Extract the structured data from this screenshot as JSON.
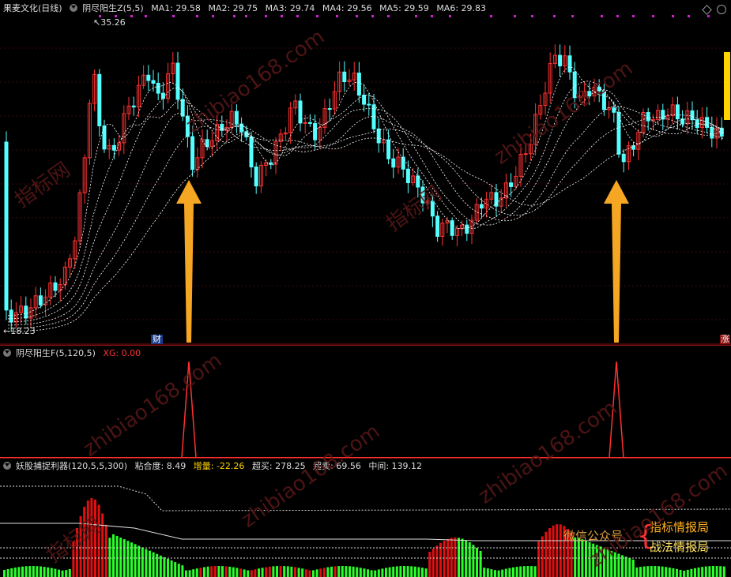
{
  "main": {
    "stock_title": "果麦文化(日线)",
    "indicator": "阴尽阳生Z(5,5)",
    "ma": [
      {
        "label": "MA1: 29.58",
        "color": "#ffffff"
      },
      {
        "label": "MA2: 29.75",
        "color": "#ffffff"
      },
      {
        "label": "MA3: 29.74",
        "color": "#ffffff"
      },
      {
        "label": "MA4: 29.56",
        "color": "#ffffff"
      },
      {
        "label": "MA5: 29.59",
        "color": "#ffffff"
      },
      {
        "label": "MA6: 29.83",
        "color": "#ffffff"
      }
    ],
    "high_label": "35.26",
    "low_label": "18.23",
    "cai_badge": "财",
    "zhang_badge": "涨"
  },
  "sub1": {
    "title": "阴尽阳生F(5,120,5)",
    "xg": "XG: 0.00"
  },
  "sub2": {
    "title": "妖股捕捉利器(120,5,5,300)",
    "nianhe": "粘合度: 8.49",
    "zengliang": "增量: -22.26",
    "chaomai": "超买: 278.25",
    "chaomai2": "超卖: 69.56",
    "zhongjian": "中间: 139.12",
    "wechat_label": "微信公众号",
    "box1": "指标情报局",
    "box2": "战法情报局"
  },
  "watermarks": [
    "指标网",
    "zhibiao168.com",
    "zhibiao168.com",
    "指标网",
    "zhibiao168.com",
    "zhibiao168.com",
    "指标网",
    "zhibiao168.com",
    "zhibiao168.com"
  ],
  "colors": {
    "up": "#ff3232",
    "down": "#54ffff",
    "ma": "#ffffff",
    "signal": "#ff3232",
    "arrow": "#f5a623",
    "grid": "#8b1010"
  }
}
